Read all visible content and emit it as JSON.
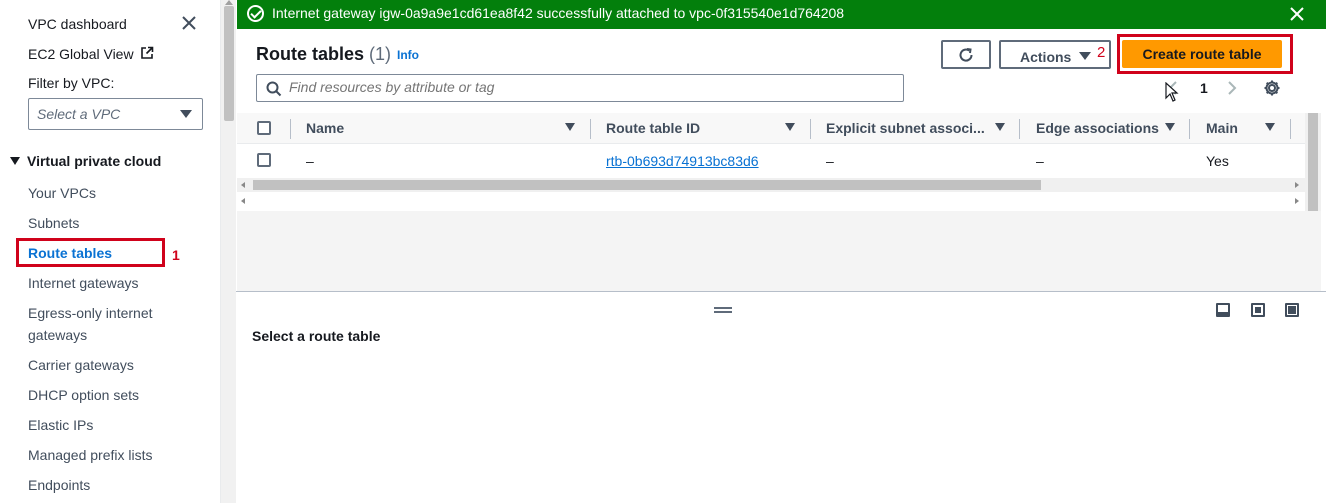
{
  "sidebar": {
    "dashboard_link": "VPC dashboard",
    "global_view_link": "EC2 Global View",
    "filter_label": "Filter by VPC:",
    "vpc_select_placeholder": "Select a VPC",
    "section_title": "Virtual private cloud",
    "items": [
      {
        "label": "Your VPCs"
      },
      {
        "label": "Subnets"
      },
      {
        "label": "Route tables"
      },
      {
        "label": "Internet gateways"
      },
      {
        "label": "Egress-only internet gateways"
      },
      {
        "label": "Carrier gateways"
      },
      {
        "label": "DHCP option sets"
      },
      {
        "label": "Elastic IPs"
      },
      {
        "label": "Managed prefix lists"
      },
      {
        "label": "Endpoints"
      }
    ],
    "active_item": "Route tables",
    "annotation_1": "1"
  },
  "flash": {
    "message": "Internet gateway igw-0a9a9e1cd61ea8f42 successfully attached to vpc-0f315540e1d764208",
    "color": "#037f0c"
  },
  "header": {
    "title": "Route tables",
    "count": "(1)",
    "info_label": "Info",
    "actions_label": "Actions",
    "create_label": "Create route table",
    "annotation_2": "2",
    "search_placeholder": "Find resources by attribute or tag",
    "page_number": "1"
  },
  "table": {
    "columns": [
      "Name",
      "Route table ID",
      "Explicit subnet associ...",
      "Edge associations",
      "Main"
    ],
    "rows": [
      {
        "name": "–",
        "route_table_id": "rtb-0b693d74913bc83d6",
        "explicit_subnet": "–",
        "edge": "–",
        "main": "Yes"
      }
    ]
  },
  "split_panel": {
    "title": "Select a route table"
  },
  "colors": {
    "accent": "#0972d3",
    "primary_button": "#ff9900",
    "annotation": "#d0021b"
  }
}
